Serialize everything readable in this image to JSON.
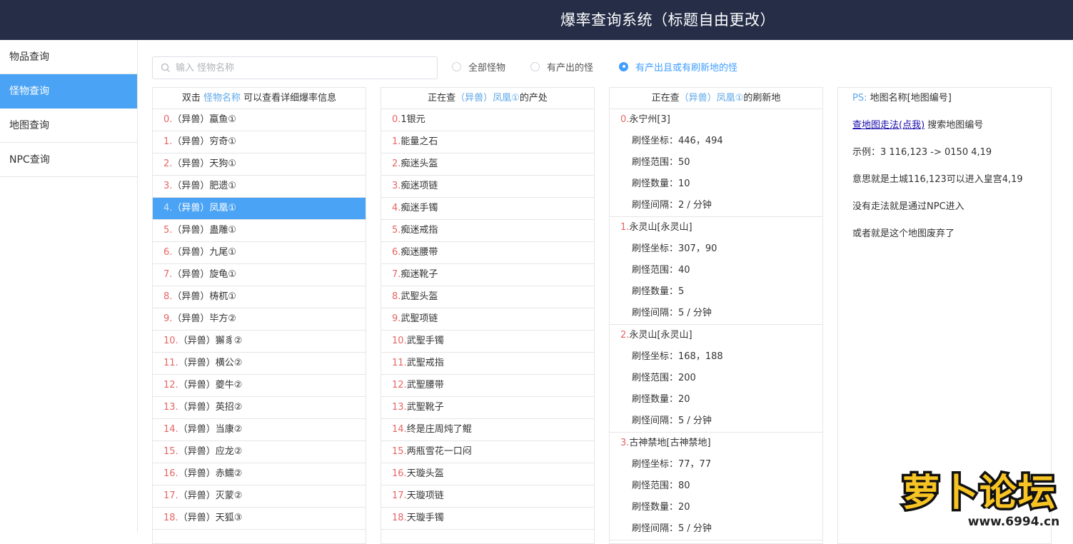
{
  "header": {
    "title": "爆率查询系统（标题自由更改）"
  },
  "sidebar": {
    "items": [
      {
        "label": "物品查询"
      },
      {
        "label": "怪物查询"
      },
      {
        "label": "地图查询"
      },
      {
        "label": "NPC查询"
      }
    ],
    "active_index": 1
  },
  "search": {
    "placeholder": "输入 怪物名称",
    "value": ""
  },
  "filters": {
    "options": [
      "全部怪物",
      "有产出的怪",
      "有产出且或有刷新地的怪"
    ],
    "selected_index": 2
  },
  "monsters": {
    "header_prefix": "双击 ",
    "header_highlight": "怪物名称",
    "header_suffix": " 可以查看详细爆率信息",
    "selected_index": 4,
    "items": [
      {
        "num": "0.",
        "name": "（异兽）蠃鱼①"
      },
      {
        "num": "1.",
        "name": "（异兽）穷奇①"
      },
      {
        "num": "2.",
        "name": "（异兽）天狗①"
      },
      {
        "num": "3.",
        "name": "（异兽）肥遗①"
      },
      {
        "num": "4.",
        "name": "（异兽）凤凰①"
      },
      {
        "num": "5.",
        "name": "（异兽）蛊雕①"
      },
      {
        "num": "6.",
        "name": "（异兽）九尾①"
      },
      {
        "num": "7.",
        "name": "（异兽）旋龟①"
      },
      {
        "num": "8.",
        "name": "（异兽）梼杌①"
      },
      {
        "num": "9.",
        "name": "（异兽）毕方②"
      },
      {
        "num": "10.",
        "name": "（异兽）獬豸②"
      },
      {
        "num": "11.",
        "name": "（异兽）横公②"
      },
      {
        "num": "12.",
        "name": "（异兽）夔牛②"
      },
      {
        "num": "13.",
        "name": "（异兽）英招②"
      },
      {
        "num": "14.",
        "name": "（异兽）当康②"
      },
      {
        "num": "15.",
        "name": "（异兽）应龙②"
      },
      {
        "num": "16.",
        "name": "（异兽）赤鱬②"
      },
      {
        "num": "17.",
        "name": "（异兽）灭蒙②"
      },
      {
        "num": "18.",
        "name": "（异兽）天狐③"
      }
    ]
  },
  "drops": {
    "header_prefix": "正在查",
    "header_highlight": "（异兽）凤凰①",
    "header_suffix": "的产处",
    "items": [
      {
        "num": "0.",
        "name": "1银元"
      },
      {
        "num": "1.",
        "name": "能量之石"
      },
      {
        "num": "2.",
        "name": "痴迷头盔"
      },
      {
        "num": "3.",
        "name": "痴迷项链"
      },
      {
        "num": "4.",
        "name": "痴迷手镯"
      },
      {
        "num": "5.",
        "name": "痴迷戒指"
      },
      {
        "num": "6.",
        "name": "痴迷腰带"
      },
      {
        "num": "7.",
        "name": "痴迷靴子"
      },
      {
        "num": "8.",
        "name": "武聖头盔"
      },
      {
        "num": "9.",
        "name": "武聖项链"
      },
      {
        "num": "10.",
        "name": "武聖手镯"
      },
      {
        "num": "11.",
        "name": "武聖戒指"
      },
      {
        "num": "12.",
        "name": "武聖腰带"
      },
      {
        "num": "13.",
        "name": "武聖靴子"
      },
      {
        "num": "14.",
        "name": "终是庄周炖了鲲"
      },
      {
        "num": "15.",
        "name": "两瓶雪花一口闷"
      },
      {
        "num": "16.",
        "name": "天璇头盔"
      },
      {
        "num": "17.",
        "name": "天璇项链"
      },
      {
        "num": "18.",
        "name": "天璇手镯"
      }
    ]
  },
  "spawns": {
    "header_prefix": "正在查",
    "header_highlight": "（异兽）凤凰①",
    "header_suffix": "的刷新地",
    "items": [
      {
        "num": "0.",
        "map": "永宁州[3]",
        "coord": "刷怪坐标：446，494",
        "range": "刷怪范围：50",
        "count": "刷怪数量：10",
        "interval": "刷怪间隔：2 / 分钟"
      },
      {
        "num": "1.",
        "map": "永灵山[永灵山]",
        "coord": "刷怪坐标：307，90",
        "range": "刷怪范围：40",
        "count": "刷怪数量：5",
        "interval": "刷怪间隔：5 / 分钟"
      },
      {
        "num": "2.",
        "map": "永灵山[永灵山]",
        "coord": "刷怪坐标：168，188",
        "range": "刷怪范围：200",
        "count": "刷怪数量：20",
        "interval": "刷怪间隔：5 / 分钟"
      },
      {
        "num": "3.",
        "map": "古神禁地[古神禁地]",
        "coord": "刷怪坐标：77，77",
        "range": "刷怪范围：80",
        "count": "刷怪数量：20",
        "interval": "刷怪间隔：5 / 分钟"
      }
    ]
  },
  "info": {
    "ps_label": "PS:",
    "ps_text": " 地图名称[地图编号]",
    "link_text": "查地图走法(点我)",
    "link_suffix": " 搜索地图编号",
    "example": "示例：3 116,123 -> 0150 4,19",
    "meaning": "意思就是土城116,123可以进入皇宫4,19",
    "no_path": "没有走法就是通过NPC进入",
    "abandoned": "或者就是这个地图废弃了"
  },
  "watermark": {
    "text": "萝卜论坛",
    "url": "www.6994.cn"
  },
  "colors": {
    "header_bg": "#252d47",
    "accent": "#4aa3f4",
    "highlight_text": "#5ea7e8",
    "index_red": "#e86464",
    "radio_checked": "#409eff"
  }
}
